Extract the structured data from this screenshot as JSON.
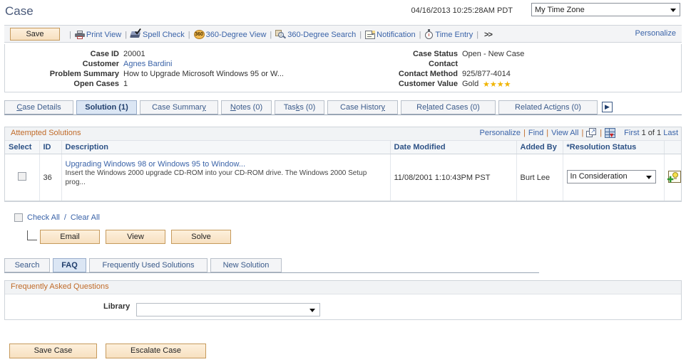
{
  "header": {
    "page_title": "Case",
    "timestamp": "04/16/2013 10:25:28AM PDT",
    "timezone_selected": "My Time Zone"
  },
  "toolbar": {
    "save_label": "Save",
    "sep": "|",
    "print_view": "Print View",
    "spell_check": "Spell Check",
    "degree_view": "360-Degree View",
    "degree_search": "360-Degree Search",
    "notification": "Notification",
    "time_entry": "Time Entry",
    "more": ">>",
    "personalize": "Personalize",
    "badge_360": "360"
  },
  "case_info": {
    "left": [
      {
        "label": "Case ID",
        "value": "20001",
        "link": false
      },
      {
        "label": "Customer",
        "value": "Agnes Bardini",
        "link": true
      },
      {
        "label": "Problem Summary",
        "value": "How to Upgrade Microsoft Windows 95 or W...",
        "link": false
      },
      {
        "label": "Open Cases",
        "value": "1",
        "link": false
      }
    ],
    "right": [
      {
        "label": "Case Status",
        "value": "Open - New Case"
      },
      {
        "label": "Contact",
        "value": ""
      },
      {
        "label": "Contact Method",
        "value": "925/877-4014"
      },
      {
        "label": "Customer Value",
        "value": "Gold"
      }
    ],
    "stars": "★★★★"
  },
  "main_tabs": [
    {
      "label": "Case Details",
      "pre": "",
      "key": "C",
      "post": "ase Details",
      "active": false
    },
    {
      "label": "Solution (1)",
      "pre": "",
      "key": "",
      "post": "Solution (1)",
      "active": true
    },
    {
      "label": "Case Summary",
      "pre": "Case Summar",
      "key": "y",
      "post": "",
      "active": false
    },
    {
      "label": "Notes (0)",
      "pre": "",
      "key": "N",
      "post": "otes (0)",
      "active": false
    },
    {
      "label": "Tasks (0)",
      "pre": "Tas",
      "key": "k",
      "post": "s (0)",
      "active": false
    },
    {
      "label": "Case History",
      "pre": "Case Histor",
      "key": "y",
      "post": "",
      "active": false
    },
    {
      "label": "Related Cases (0)",
      "pre": "Re",
      "key": "l",
      "post": "ated Cases (0)",
      "active": false
    },
    {
      "label": "Related Actions (0)",
      "pre": "Related Acti",
      "key": "o",
      "post": "ns (0)",
      "active": false
    }
  ],
  "tab_next_glyph": "▶",
  "grid": {
    "title": "Attempted Solutions",
    "nav": {
      "personalize": "Personalize",
      "find": "Find",
      "view_all": "View All",
      "sep": "|"
    },
    "paging": {
      "first": "First",
      "range": "1 of 1",
      "last": "Last"
    },
    "columns": [
      "Select",
      "ID",
      "Description",
      "Date Modified",
      "Added By",
      "*Resolution Status",
      ""
    ],
    "rows": [
      {
        "id": "36",
        "desc_link": "Upgrading Windows 98 or Windows 95 to Window...",
        "desc_body": "Insert the Windows 2000 upgrade CD-ROM into your CD-ROM drive. The Windows 2000 Setup prog...",
        "date_modified": "11/08/2001  1:10:43PM PST",
        "added_by": "Burt Lee",
        "resolution_status": "In Consideration"
      }
    ]
  },
  "check_all": {
    "check": "Check All",
    "slash": "/",
    "clear": "Clear All"
  },
  "action_buttons": [
    {
      "label": "Email"
    },
    {
      "label": "View"
    },
    {
      "label": "Solve"
    }
  ],
  "lower_tabs": [
    {
      "label": "Search",
      "active": false
    },
    {
      "label": "FAQ",
      "active": true
    },
    {
      "label": "Frequently Used Solutions",
      "active": false
    },
    {
      "label": "New Solution",
      "active": false
    }
  ],
  "faq": {
    "title": "Frequently Asked Questions",
    "library_label": "Library",
    "library_value": ""
  },
  "bottom_buttons": {
    "save_case": "Save Case",
    "escalate_case": "Escalate Case"
  },
  "colors": {
    "accent_orange": "#c06a28",
    "link_blue": "#3a63a8",
    "tab_active": "#dbe6f4",
    "button_face": "#f7e0c0",
    "star_gold": "#f0b400"
  }
}
